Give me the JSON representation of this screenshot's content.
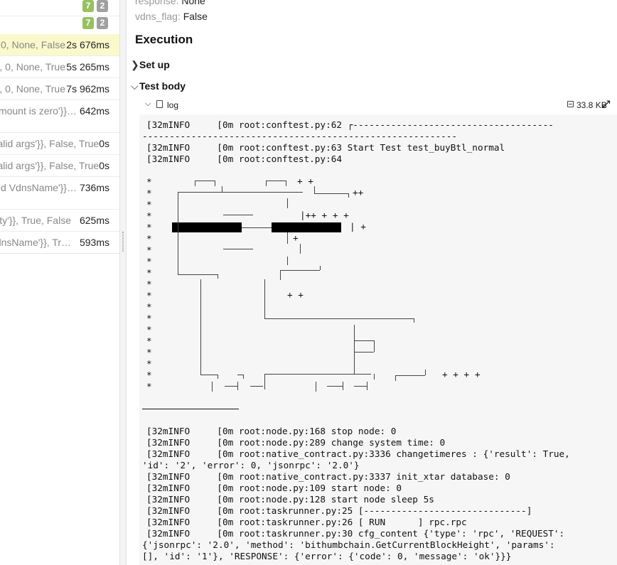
{
  "left_panel": {
    "badge_rows": [
      {
        "passed": "7",
        "skipped": "2"
      },
      {
        "passed": "7",
        "skipped": "2"
      }
    ],
    "rows": [
      {
        "params": "0, None, False",
        "duration": "2s 676ms",
        "selected": true
      },
      {
        "params": ", 0, None, True",
        "duration": "5s 265ms"
      },
      {
        "params": ", 0, None, True",
        "duration": "7s 962ms"
      },
      {
        "params": "mount is zero'}}…",
        "duration": "642ms"
      },
      {
        "params": "alid args'}}, False, True",
        "duration": "0s"
      },
      {
        "params": "alid args'}}, False, True",
        "duration": "0s"
      },
      {
        "params": "id VdnsName'}}…",
        "duration": "736ms"
      },
      {
        "params": "pty'}}, True, False",
        "duration": "625ms"
      },
      {
        "params": "dnsName'}}, Tr…",
        "duration": "593ms"
      }
    ]
  },
  "right_panel": {
    "partial_param": {
      "key": "response",
      "value": "None"
    },
    "vdns_flag": {
      "key": "vdns_flag",
      "value": "False"
    },
    "execution_title": "Execution",
    "setup_label": "Set up",
    "test_body_label": "Test body",
    "log": {
      "name": "log",
      "size": "33.8 KB",
      "top_lines": [
        "[32mINFO     [0m root:conftest.py:62 ┌-------------------------------------",
        "----------------------------------------------------------",
        "[32mINFO     [0m root:conftest.py:63 Start Test test_buyBtl_normal",
        "[32mINFO     [0m root:conftest.py:64"
      ],
      "star_rows": [
        "*",
        "*",
        "*",
        "*",
        "*",
        "*",
        "*",
        "*",
        "*",
        "*",
        "*",
        "*",
        "*",
        "*",
        "*",
        "*",
        "*",
        "*",
        "*"
      ],
      "ascii_marks": [
        "+ +",
        "++",
        "|++ + + +",
        "| +",
        "+",
        "+ +",
        "+ + + +"
      ],
      "bottom_lines": [
        "[32mINFO     [0m root:node.py:168 stop node: 0",
        "[32mINFO     [0m root:node.py:289 change system time: 0",
        "[32mINFO     [0m root:native_contract.py:3336 changetimeres : {'result': True,",
        "'id': '2', 'error': 0, 'jsonrpc': '2.0'}",
        "[32mINFO     [0m root:native_contract.py:3337 init_xtar database: 0",
        "[32mINFO     [0m root:node.py:109 start node: 0",
        "[32mINFO     [0m root:node.py:128 start node sleep 5s",
        "[32mINFO     [0m root:taskrunner.py:25 [------------------------------]",
        "[32mINFO     [0m root:taskrunner.py:26 [ RUN      ] rpc.rpc",
        "[32mINFO     [0m root:taskrunner.py:30 cfg_content {'type': 'rpc', 'REQUEST':",
        "{'jsonrpc': '2.0', 'method': 'bithumbchain.GetCurrentBlockHeight', 'params':",
        "[], 'id': '1'}, 'RESPONSE': {'error': {'code': 0, 'message': 'ok'}}}"
      ]
    }
  },
  "colors": {
    "selected_row": "#fbf8cc",
    "badge_passed": "#97c060",
    "badge_skipped": "#a0a0a0",
    "log_background": "#f6f6f6"
  },
  "icons": [
    "chevron-right-icon",
    "chevron-down-icon",
    "file-icon",
    "save-icon",
    "expand-icon"
  ]
}
